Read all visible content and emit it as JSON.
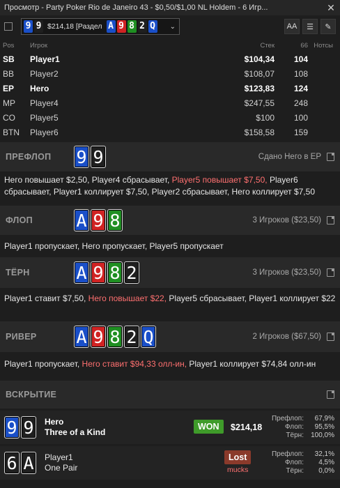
{
  "window": {
    "title": "Просмотр - Party Poker Rio de Janeiro 43 - $0,50/$1,00 NL Holdem - 6 Игр...",
    "close": "✕"
  },
  "colors": {
    "spade": "#1f1f1f",
    "heart": "#d02323",
    "diamond": "#1a4fc8",
    "club": "#1f8f22",
    "won": "#3f9b2a",
    "lost": "#8a3a2b",
    "accent_red": "#ff7070"
  },
  "toolbar": {
    "hand_selector": {
      "cards": [
        {
          "rank": "9",
          "suit": "diamond"
        },
        {
          "rank": "9",
          "suit": "spade"
        }
      ],
      "text": "$214,18 [Раздел",
      "board": [
        {
          "rank": "A",
          "suit": "diamond"
        },
        {
          "rank": "9",
          "suit": "heart"
        },
        {
          "rank": "8",
          "suit": "club"
        },
        {
          "rank": "2",
          "suit": "spade"
        },
        {
          "rank": "Q",
          "suit": "diamond"
        }
      ],
      "chevron": "⌄"
    },
    "buttons": [
      {
        "name": "font-size-button",
        "label": "AA"
      },
      {
        "name": "list-button",
        "label": "☰"
      },
      {
        "name": "edit-button",
        "label": "✎"
      }
    ]
  },
  "players": {
    "headers": {
      "pos": "Pos",
      "name": "Игрок",
      "stack": "Стек",
      "bb": "66",
      "notes": "Нотсы"
    },
    "rows": [
      {
        "pos": "SB",
        "name": "Player1",
        "stack": "$104,34",
        "bb": "104",
        "bold": true
      },
      {
        "pos": "BB",
        "name": "Player2",
        "stack": "$108,07",
        "bb": "108",
        "bold": false
      },
      {
        "pos": "EP",
        "name": "Hero",
        "stack": "$123,83",
        "bb": "124",
        "bold": true
      },
      {
        "pos": "MP",
        "name": "Player4",
        "stack": "$247,55",
        "bb": "248",
        "bold": false
      },
      {
        "pos": "CO",
        "name": "Player5",
        "stack": "$100",
        "bb": "100",
        "bold": false
      },
      {
        "pos": "BTN",
        "name": "Player6",
        "stack": "$158,58",
        "bb": "159",
        "bold": false
      }
    ]
  },
  "streets": {
    "preflop": {
      "name": "ПРЕФЛОП",
      "cards": [
        {
          "rank": "9",
          "suit": "diamond"
        },
        {
          "rank": "9",
          "suit": "spade"
        }
      ],
      "right": "Сдано Него в EP",
      "actions": [
        {
          "text": "Него повышает $2,50, Player4 сбрасывает, ",
          "red": false
        },
        {
          "text": "Player5 повышает $7,50,",
          "red": true
        },
        {
          "text": " Player6 сбрасывает, Player1 коллирует $7,50, Player2 сбрасывает, Него коллирует $7,50",
          "red": false
        }
      ]
    },
    "flop": {
      "name": "ФЛОП",
      "cards": [
        {
          "rank": "A",
          "suit": "diamond"
        },
        {
          "rank": "9",
          "suit": "heart"
        },
        {
          "rank": "8",
          "suit": "club"
        }
      ],
      "right": "3 Игроков ($23,50)",
      "actions": [
        {
          "text": "Player1 пропускает, Него пропускает, Player5 пропускает",
          "red": false
        }
      ]
    },
    "turn": {
      "name": "ТЁРН",
      "cards": [
        {
          "rank": "A",
          "suit": "diamond"
        },
        {
          "rank": "9",
          "suit": "heart"
        },
        {
          "rank": "8",
          "suit": "club"
        },
        {
          "rank": "2",
          "suit": "spade"
        }
      ],
      "right": "3 Игроков ($23,50)",
      "actions": [
        {
          "text": "Player1 ставит $7,50, ",
          "red": false
        },
        {
          "text": "Него повышает $22,",
          "red": true
        },
        {
          "text": " Player5 сбрасывает, Player1 коллирует $22",
          "red": false
        }
      ]
    },
    "river": {
      "name": "РИВЕР",
      "cards": [
        {
          "rank": "A",
          "suit": "diamond"
        },
        {
          "rank": "9",
          "suit": "heart"
        },
        {
          "rank": "8",
          "suit": "club"
        },
        {
          "rank": "2",
          "suit": "spade"
        },
        {
          "rank": "Q",
          "suit": "diamond"
        }
      ],
      "right": "2 Игроков ($67,50)",
      "actions": [
        {
          "text": "Player1 пропускает, ",
          "red": false
        },
        {
          "text": "Него ставит $94,33 олл-ин,",
          "red": true
        },
        {
          "text": " Player1 коллирует $74,84 олл-ин",
          "red": false
        }
      ]
    }
  },
  "showdown": {
    "name": "ВСКРЫТИЕ",
    "hero": {
      "cards": [
        {
          "rank": "9",
          "suit": "diamond"
        },
        {
          "rank": "9",
          "suit": "spade"
        }
      ],
      "name": "Hero",
      "hand": "Three of a Kind",
      "badge": "WON",
      "amount": "$214,18",
      "equity": [
        {
          "label": "Префлоп:",
          "value": "67,9%"
        },
        {
          "label": "Флоп:",
          "value": "95,5%"
        },
        {
          "label": "Тёрн:",
          "value": "100,0%"
        }
      ]
    },
    "villain": {
      "cards": [
        {
          "rank": "6",
          "suit": "spade"
        },
        {
          "rank": "A",
          "suit": "spade"
        }
      ],
      "name": "Player1",
      "hand": "One Pair",
      "badge": "Lost",
      "sub": "mucks",
      "equity": [
        {
          "label": "Префлоп:",
          "value": "32,1%"
        },
        {
          "label": "Флоп:",
          "value": "4,5%"
        },
        {
          "label": "Тёрн:",
          "value": "0,0%"
        }
      ]
    }
  }
}
